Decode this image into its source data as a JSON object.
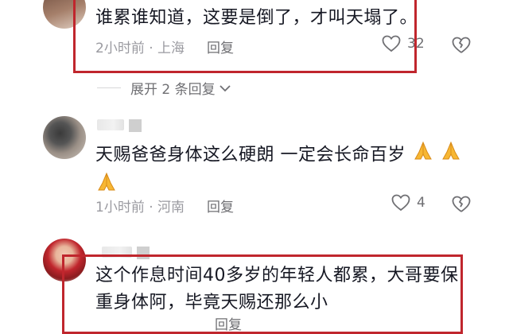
{
  "comments": [
    {
      "text": "谁累谁知道，这要是倒了，才叫天塌了。",
      "time_location": "2小时前 · 上海",
      "reply_label": "回复",
      "likes": "32",
      "expand_label": "展开 2 条回复"
    },
    {
      "text_line1": "天赐爸爸身体这么硬朗 一定会长命百岁",
      "time_location": "1小时前 · 河南",
      "reply_label": "回复",
      "likes": "4",
      "emoji_name": "folded-hands"
    },
    {
      "text_line1": "这个作息时间40多岁的年轻人都累，大哥要保",
      "text_line2": "重身体阿，毕竟天赐还那么小",
      "reply_label": "回复"
    }
  ],
  "colors": {
    "highlight_border": "#c0262d",
    "text": "#161823",
    "meta": "#9a9aa0"
  },
  "icons": [
    "heart-outline-icon",
    "broken-heart-icon",
    "chevron-down-icon",
    "folded-hands-emoji"
  ]
}
